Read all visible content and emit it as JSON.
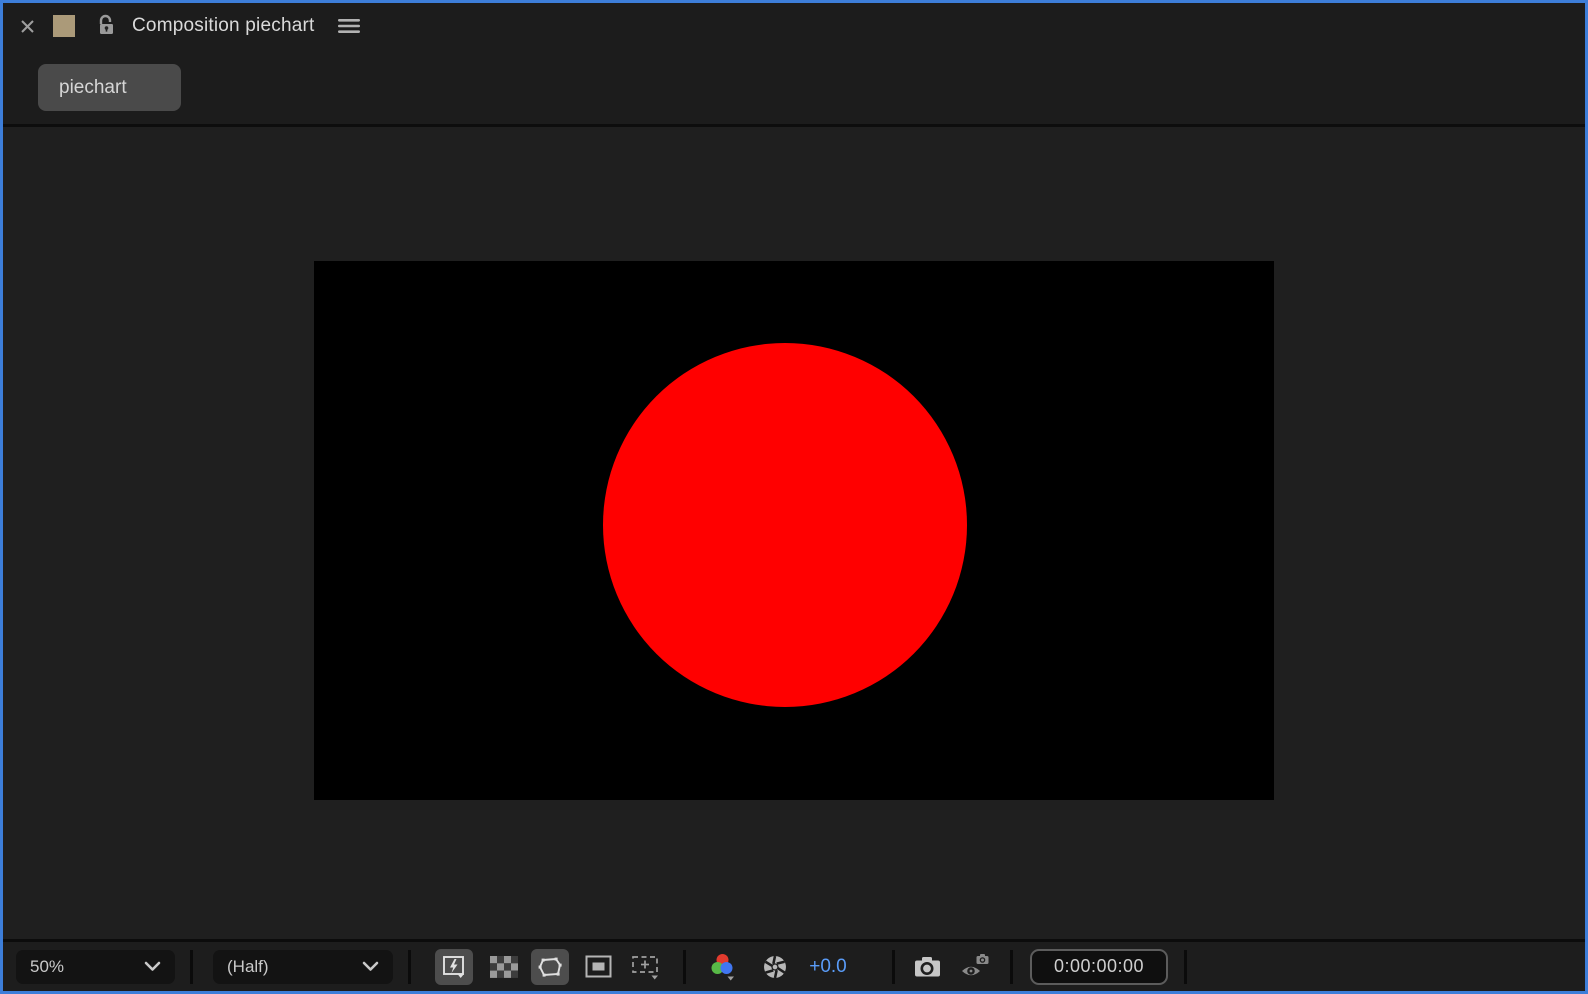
{
  "panel": {
    "title": "Composition piechart",
    "active_tab": "piechart"
  },
  "toolbar": {
    "magnification": "50%",
    "resolution": "(Half)",
    "exposure": "+0.0",
    "timecode": "0:00:00:00"
  },
  "colors": {
    "focus_border": "#3d7ed9",
    "panel_background": "#1d1d1d",
    "viewer_background": "#1f1f1f",
    "composition_background": "#000000",
    "circle_fill": "#ff0000",
    "tab_background": "#4a4a4a",
    "drag_handle_swatch": "#ab9a79",
    "exposure_text": "#5a9cf8"
  },
  "icons": {
    "close-icon": "×",
    "panel-swatch": "tan square",
    "unlock-icon": "open padlock",
    "panel-menu-icon": "≡",
    "chevron-down-icon": "⌄",
    "fast-previews-icon": "lightning bolt in frame",
    "transparency-grid-icon": "checkerboard",
    "mask-visibility-icon": "polygon outline with vertices",
    "region-of-interest-icon": "rectangle in frame",
    "guide-options-icon": "dashed frame with plus",
    "show-channel-icon": "red green blue circles",
    "exposure-icon": "camera aperture",
    "snapshot-icon": "camera",
    "show-snapshot-icon": "eye with camera"
  }
}
